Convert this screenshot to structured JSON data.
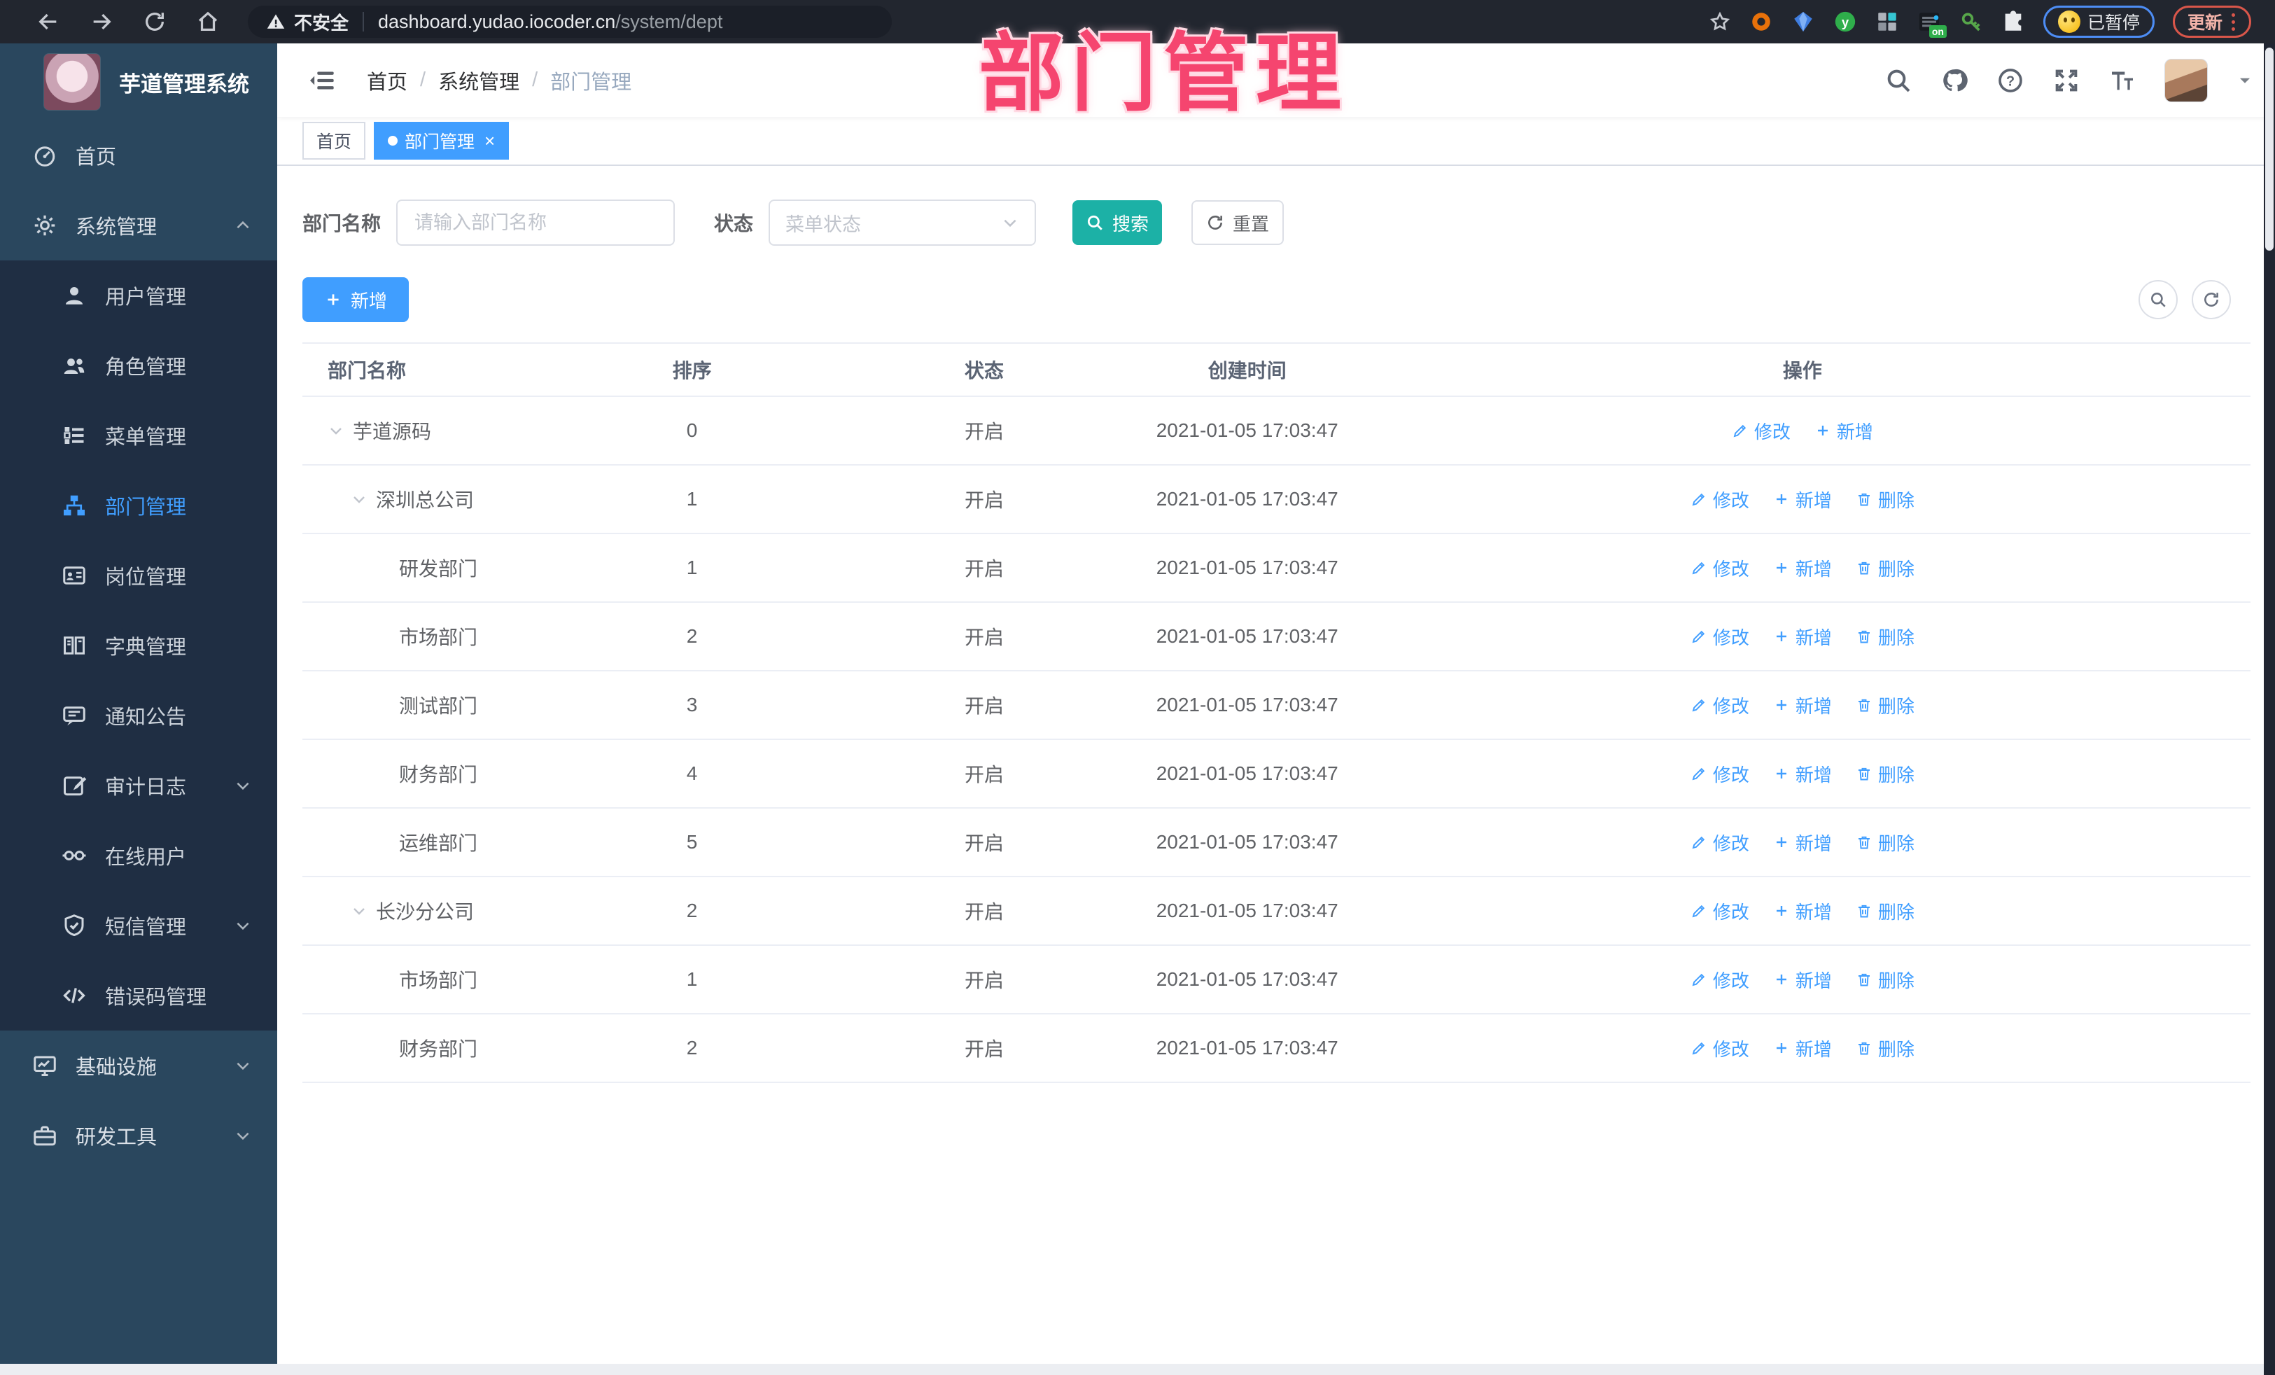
{
  "browser": {
    "security_label": "不安全",
    "url_host": "dashboard.yudao.iocoder.cn",
    "url_path": "/system/dept",
    "profile_status": "已暂停",
    "update_label": "更新",
    "extension_badge": "on"
  },
  "overlay": {
    "title": "部门管理",
    "color": "#f5456f"
  },
  "sidebar": {
    "app_title": "芋道管理系统",
    "colors": {
      "bg": "#2a475e",
      "submenu_bg": "#1f2e43",
      "active": "#409eff"
    },
    "items": [
      {
        "label": "首页",
        "icon": "dashboard-icon",
        "level": "top"
      },
      {
        "label": "系统管理",
        "icon": "gear-icon",
        "level": "top",
        "chevron": "up"
      },
      {
        "label": "用户管理",
        "icon": "user-icon",
        "level": "sub"
      },
      {
        "label": "角色管理",
        "icon": "users-icon",
        "level": "sub"
      },
      {
        "label": "菜单管理",
        "icon": "menu-list-icon",
        "level": "sub"
      },
      {
        "label": "部门管理",
        "icon": "org-tree-icon",
        "level": "sub",
        "active": true
      },
      {
        "label": "岗位管理",
        "icon": "id-card-icon",
        "level": "sub"
      },
      {
        "label": "字典管理",
        "icon": "book-icon",
        "level": "sub"
      },
      {
        "label": "通知公告",
        "icon": "announcement-icon",
        "level": "sub"
      },
      {
        "label": "审计日志",
        "icon": "audit-log-icon",
        "level": "sub",
        "chevron": "down"
      },
      {
        "label": "在线用户",
        "icon": "online-user-icon",
        "level": "sub"
      },
      {
        "label": "短信管理",
        "icon": "shield-check-icon",
        "level": "sub",
        "chevron": "down"
      },
      {
        "label": "错误码管理",
        "icon": "code-icon",
        "level": "sub"
      },
      {
        "label": "基础设施",
        "icon": "monitor-icon",
        "level": "top",
        "chevron": "down"
      },
      {
        "label": "研发工具",
        "icon": "toolbox-icon",
        "level": "top",
        "chevron": "down"
      }
    ]
  },
  "navbar": {
    "breadcrumb": [
      {
        "label": "首页"
      },
      {
        "label": "系统管理"
      },
      {
        "label": "部门管理",
        "current": true
      }
    ]
  },
  "tags": [
    {
      "label": "首页"
    },
    {
      "label": "部门管理",
      "active": true,
      "closable": true
    }
  ],
  "filters": {
    "dept_name_label": "部门名称",
    "dept_name_placeholder": "请输入部门名称",
    "status_label": "状态",
    "status_placeholder": "菜单状态",
    "search_label": "搜索",
    "reset_label": "重置"
  },
  "toolbar": {
    "add_label": "新增"
  },
  "table": {
    "columns": [
      "部门名称",
      "排序",
      "状态",
      "创建时间",
      "操作"
    ],
    "action_labels": {
      "edit": "修改",
      "add": "新增",
      "delete": "删除"
    },
    "rows": [
      {
        "name": "芋道源码",
        "indent": 0,
        "expandable": true,
        "sort": "0",
        "status": "开启",
        "time": "2021-01-05 17:03:47",
        "actions": [
          "edit",
          "add"
        ]
      },
      {
        "name": "深圳总公司",
        "indent": 1,
        "expandable": true,
        "sort": "1",
        "status": "开启",
        "time": "2021-01-05 17:03:47",
        "actions": [
          "edit",
          "add",
          "delete"
        ]
      },
      {
        "name": "研发部门",
        "indent": 2,
        "expandable": false,
        "sort": "1",
        "status": "开启",
        "time": "2021-01-05 17:03:47",
        "actions": [
          "edit",
          "add",
          "delete"
        ]
      },
      {
        "name": "市场部门",
        "indent": 2,
        "expandable": false,
        "sort": "2",
        "status": "开启",
        "time": "2021-01-05 17:03:47",
        "actions": [
          "edit",
          "add",
          "delete"
        ]
      },
      {
        "name": "测试部门",
        "indent": 2,
        "expandable": false,
        "sort": "3",
        "status": "开启",
        "time": "2021-01-05 17:03:47",
        "actions": [
          "edit",
          "add",
          "delete"
        ]
      },
      {
        "name": "财务部门",
        "indent": 2,
        "expandable": false,
        "sort": "4",
        "status": "开启",
        "time": "2021-01-05 17:03:47",
        "actions": [
          "edit",
          "add",
          "delete"
        ]
      },
      {
        "name": "运维部门",
        "indent": 2,
        "expandable": false,
        "sort": "5",
        "status": "开启",
        "time": "2021-01-05 17:03:47",
        "actions": [
          "edit",
          "add",
          "delete"
        ]
      },
      {
        "name": "长沙分公司",
        "indent": 1,
        "expandable": true,
        "sort": "2",
        "status": "开启",
        "time": "2021-01-05 17:03:47",
        "actions": [
          "edit",
          "add",
          "delete"
        ]
      },
      {
        "name": "市场部门",
        "indent": 2,
        "expandable": false,
        "sort": "1",
        "status": "开启",
        "time": "2021-01-05 17:03:47",
        "actions": [
          "edit",
          "add",
          "delete"
        ]
      },
      {
        "name": "财务部门",
        "indent": 2,
        "expandable": false,
        "sort": "2",
        "status": "开启",
        "time": "2021-01-05 17:03:47",
        "actions": [
          "edit",
          "add",
          "delete"
        ]
      }
    ]
  },
  "accent_colors": {
    "primary": "#409eff",
    "search_teal": "#1cb1a6",
    "tag_active": "#409eff"
  }
}
